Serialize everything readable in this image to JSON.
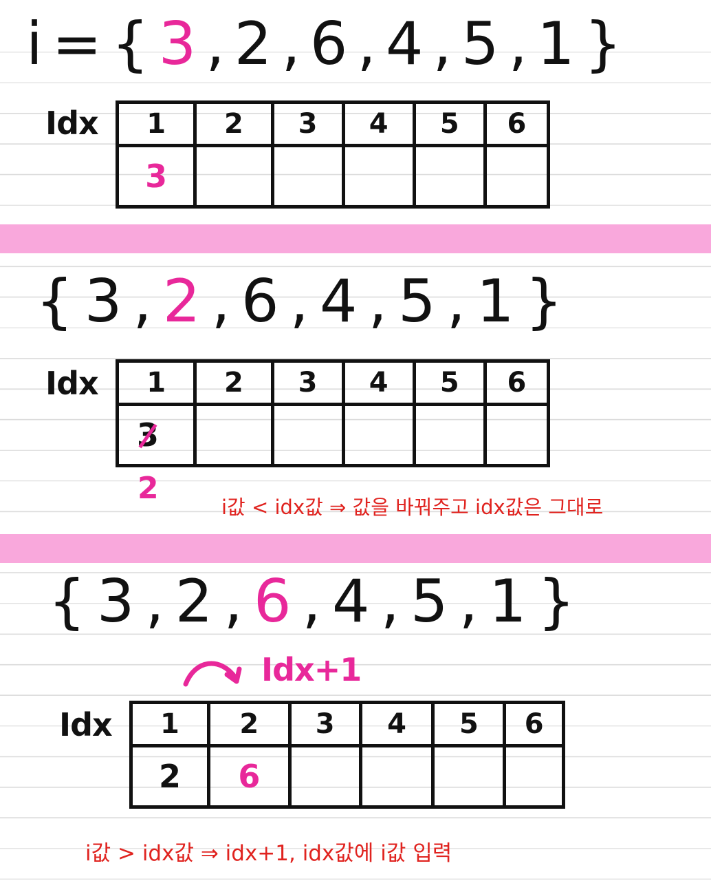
{
  "step1": {
    "sequence_prefix": "i={",
    "highlight": "3",
    "sequence_rest": ",2,6,4,5,1}",
    "idx_label": "Idx",
    "headers": [
      "1",
      "2",
      "3",
      "4",
      "5",
      "6"
    ],
    "values": [
      "3",
      "",
      "",
      "",
      "",
      ""
    ]
  },
  "step2": {
    "sequence_prefix": "{3,",
    "highlight": "2",
    "sequence_rest": ",6,4,5,1}",
    "idx_label": "Idx",
    "headers": [
      "1",
      "2",
      "3",
      "4",
      "5",
      "6"
    ],
    "values": [
      "3",
      "",
      "",
      "",
      "",
      ""
    ],
    "replaced_value": "2",
    "note": "i값 < idx값 ⇒ 값을 바꿔주고 idx값은 그대로"
  },
  "step3": {
    "sequence_prefix": "{3,2,",
    "highlight": "6",
    "sequence_rest": ",4,5,1}",
    "idx_label": "Idx",
    "increment_label": "Idx+1",
    "headers": [
      "1",
      "2",
      "3",
      "4",
      "5",
      "6"
    ],
    "values": [
      "2",
      "6",
      "",
      "",
      "",
      ""
    ],
    "note": "i값 > idx값 ⇒ idx+1, idx값에 i값 입력"
  },
  "colors": {
    "highlight": "#e8289a",
    "note": "#e0231f",
    "divider": "#f9a8dc"
  }
}
